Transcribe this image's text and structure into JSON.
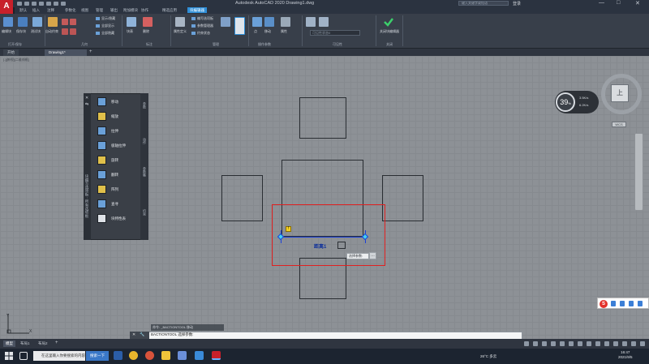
{
  "window": {
    "app_logo": "A",
    "title": "Autodesk AutoCAD 2020    Drawing1.dwg",
    "search_placeholder": "键入关键字或短语",
    "login": "登录",
    "min": "—",
    "max": "□",
    "close": "✕"
  },
  "menu_tabs": [
    "默认",
    "插入",
    "注释",
    "参数化",
    "视图",
    "管理",
    "输出",
    "附加模块",
    "协作",
    "精选应用",
    "块编辑器"
  ],
  "active_menu_tab": "块编辑器",
  "ribbon": {
    "panels": [
      {
        "title": "打开/保存",
        "buttons": [
          "编辑块",
          "保存块",
          "测试块"
        ]
      },
      {
        "title": "几何",
        "buttons": [
          "自动约束"
        ],
        "small": [
          "显示/隐藏",
          "全部显示",
          "全部隐藏"
        ]
      },
      {
        "title": "标注",
        "buttons": [
          "块表",
          "删除"
        ]
      },
      {
        "title": "管理",
        "buttons": [
          "属性定义"
        ],
        "small": [
          "编写选项板",
          "参数管理器",
          "约束状态"
        ]
      },
      {
        "title": "操作参数",
        "buttons": [
          "点",
          "移动",
          "属性"
        ]
      },
      {
        "title": "可见性",
        "buttons": [
          "可见性状态"
        ]
      },
      {
        "title": "关闭",
        "buttons": [
          "关闭块编辑器"
        ]
      }
    ],
    "combo": "可见性状态0"
  },
  "doc_tabs": [
    "开始",
    "Drawing1*"
  ],
  "active_doc_tab": "Drawing1*",
  "viewport_label": "[-][俯视][二维线框]",
  "palette": {
    "items": [
      "移动",
      "缩放",
      "拉伸",
      "极轴拉伸",
      "旋转",
      "翻转",
      "阵列",
      "查寻",
      "块特性表"
    ],
    "side_tabs": [
      "参数",
      "动作",
      "参数集",
      "约束"
    ],
    "vertical_title": "块编写选项板 - 所有选项板"
  },
  "dimension": {
    "label": "距离1",
    "warning": "!",
    "tooltip": "选择参数:",
    "tooltip_btn": "…"
  },
  "viewcube": {
    "face": "上",
    "wcs": "WCS"
  },
  "cpu_widget": {
    "value": "39",
    "unit": "%",
    "up": "3.5K/s",
    "down": "6.2K/s"
  },
  "command": {
    "history": "命令: _BACTIONTOOL 移动",
    "prompt": "BACTIONTOOL 选择参数:"
  },
  "layout_tabs": [
    "模型",
    "布局1",
    "布局2"
  ],
  "active_layout": "模型",
  "taskbar": {
    "search": "在这里输入你要搜索的内容",
    "search_btn": "搜索一下",
    "weather": "26°C 多云",
    "time": "16:47",
    "date": "2021/9/5"
  },
  "colors": {
    "accent": "#2f8fd8",
    "highlight_box": "#e02020",
    "dimension": "#1a3fd8",
    "grip": "#44d0f0",
    "canvas": "#8d9196"
  }
}
